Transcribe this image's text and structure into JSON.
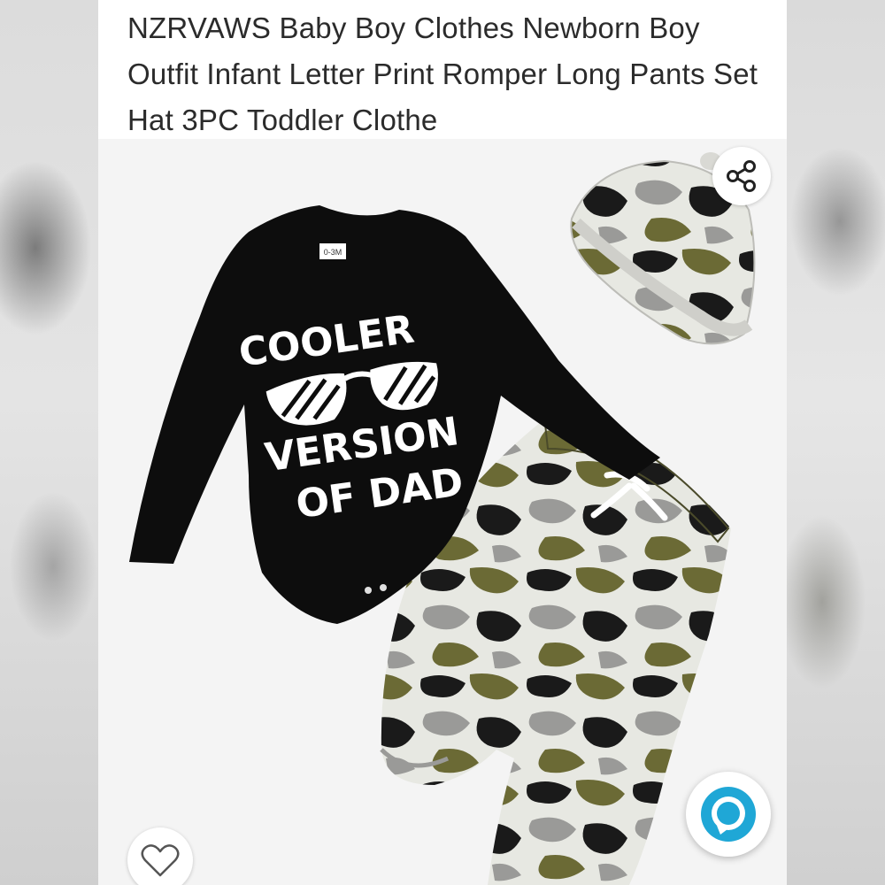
{
  "product": {
    "title": "NZRVAWS Baby Boy Clothes Newborn Boy Outfit Infant Letter Print Romper Long Pants Set Hat 3PC Toddler Clothe"
  },
  "image": {
    "romper_size_tag": "0-3M",
    "print_line1": "COOLER",
    "print_line2": "VERSION",
    "print_line3": "OF DAD"
  },
  "icons": {
    "share": "share-icon",
    "wishlist": "heart-icon",
    "assistant": "alexa-icon"
  },
  "colors": {
    "accent": "#1fa7d6",
    "romper": "#0d0d0d",
    "camo_olive": "#6b6a35",
    "camo_gray": "#9a9a98",
    "camo_light": "#e7e8e2"
  }
}
